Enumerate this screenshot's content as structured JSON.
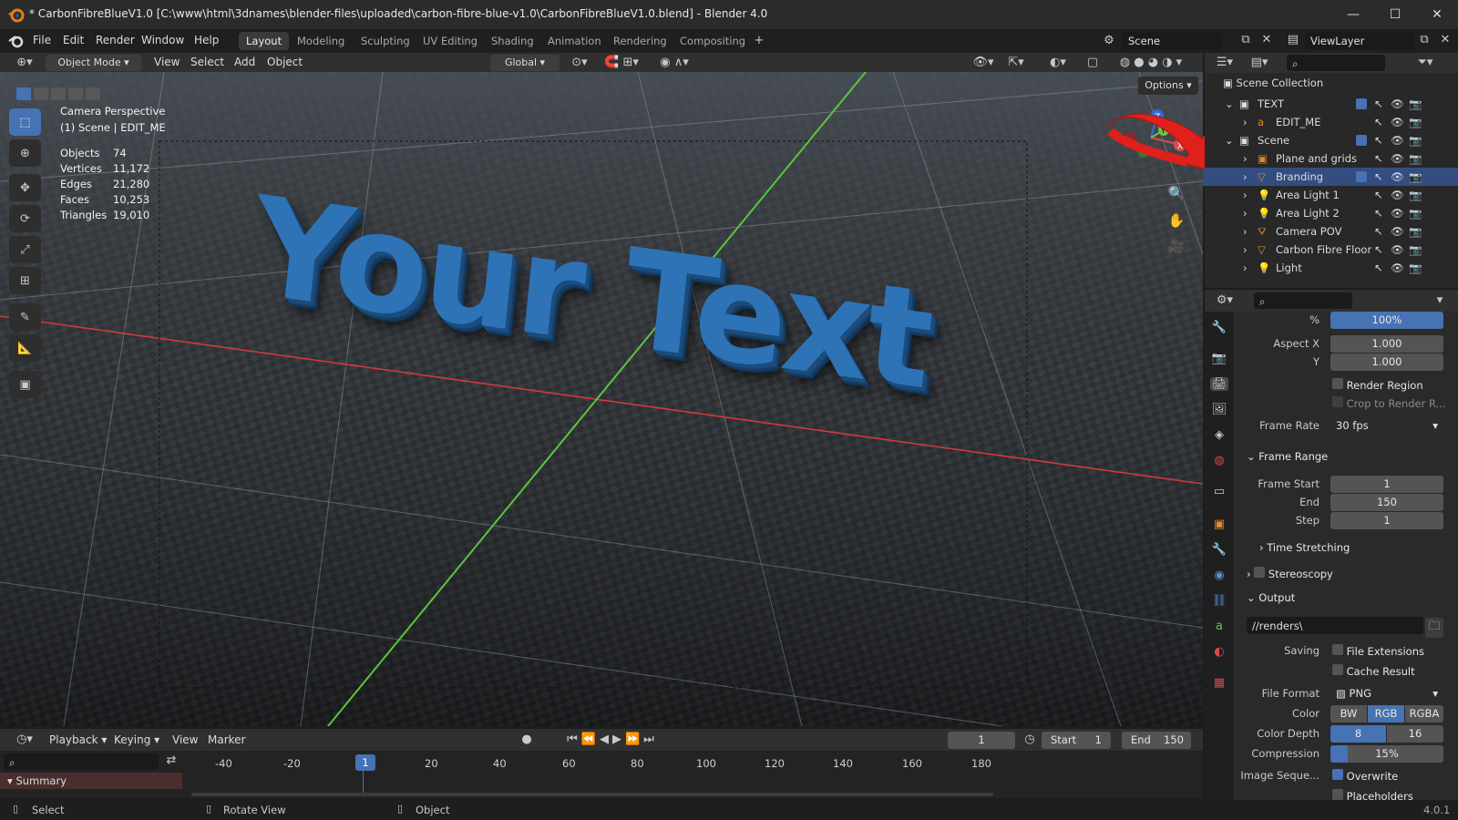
{
  "window": {
    "title": "* CarbonFibreBlueV1.0 [C:\\www\\html\\3dnames\\blender-files\\uploaded\\carbon-fibre-blue-v1.0\\CarbonFibreBlueV1.0.blend] - Blender 4.0",
    "minimize": "—",
    "maximize": "☐",
    "close": "✕"
  },
  "menu": [
    "File",
    "Edit",
    "Render",
    "Window",
    "Help"
  ],
  "workspaces": [
    "Layout",
    "Modeling",
    "Sculpting",
    "UV Editing",
    "Shading",
    "Animation",
    "Rendering",
    "Compositing"
  ],
  "scene_name": "Scene",
  "view_layer": "ViewLayer",
  "viewport_header": {
    "mode": "Object Mode",
    "menus": [
      "View",
      "Select",
      "Add",
      "Object"
    ],
    "transform": "Global",
    "options": "Options"
  },
  "overlay": {
    "camera_title": "Camera Perspective",
    "camera_sub": "(1) Scene | EDIT_ME",
    "stats": [
      {
        "label": "Objects",
        "value": "74"
      },
      {
        "label": "Vertices",
        "value": "11,172"
      },
      {
        "label": "Edges",
        "value": "21,280"
      },
      {
        "label": "Faces",
        "value": "10,253"
      },
      {
        "label": "Triangles",
        "value": "19,010"
      }
    ],
    "scene_text": "Your Text"
  },
  "outliner": {
    "root": "Scene Collection",
    "items": [
      {
        "label": "TEXT",
        "indent": 0
      },
      {
        "label": "EDIT_ME",
        "indent": 1
      },
      {
        "label": "Scene",
        "indent": 0
      },
      {
        "label": "Plane and grids",
        "indent": 1
      },
      {
        "label": "Branding",
        "indent": 1,
        "selected": true
      },
      {
        "label": "Area Light 1",
        "indent": 1
      },
      {
        "label": "Area Light 2",
        "indent": 1
      },
      {
        "label": "Camera POV",
        "indent": 1
      },
      {
        "label": "Carbon Fibre Floor",
        "indent": 1
      },
      {
        "label": "Light",
        "indent": 1
      }
    ]
  },
  "properties": {
    "percent": "100%",
    "aspect_x_label": "Aspect X",
    "aspect_x": "1.000",
    "aspect_y_label": "Y",
    "aspect_y": "1.000",
    "render_region": "Render Region",
    "crop": "Crop to Render R...",
    "frame_rate_label": "Frame Rate",
    "frame_rate": "30 fps",
    "frame_range": "Frame Range",
    "frame_start_label": "Frame Start",
    "frame_start": "1",
    "end_label": "End",
    "end": "150",
    "step_label": "Step",
    "step": "1",
    "time_stretching": "Time Stretching",
    "stereoscopy": "Stereoscopy",
    "output": "Output",
    "output_path": "//renders\\",
    "saving_label": "Saving",
    "file_extensions": "File Extensions",
    "cache_result": "Cache Result",
    "file_format_label": "File Format",
    "file_format": "PNG",
    "color_label": "Color",
    "color_opts": [
      "BW",
      "RGB",
      "RGBA"
    ],
    "color_depth_label": "Color Depth",
    "depth_opts": [
      "8",
      "16"
    ],
    "compression_label": "Compression",
    "compression": "15%",
    "compression_fraction": 0.15,
    "image_seq_label": "Image Seque...",
    "overwrite": "Overwrite",
    "placeholders": "Placeholders"
  },
  "timeline": {
    "menus": [
      "Playback",
      "Keying",
      "View",
      "Marker"
    ],
    "current_frame": "1",
    "start_label": "Start",
    "start": "1",
    "end_label": "End",
    "end": "150",
    "ticks": [
      "-40",
      "-20",
      "1",
      "20",
      "40",
      "60",
      "80",
      "100",
      "120",
      "140",
      "160",
      "180"
    ],
    "summary": "Summary"
  },
  "statusbar": {
    "select": "Select",
    "rotate": "Rotate View",
    "object": "Object",
    "version": "4.0.1"
  },
  "colors": {
    "accent": "#4772b3",
    "selected_row": "#334d80",
    "arrow": "#e0201b"
  }
}
